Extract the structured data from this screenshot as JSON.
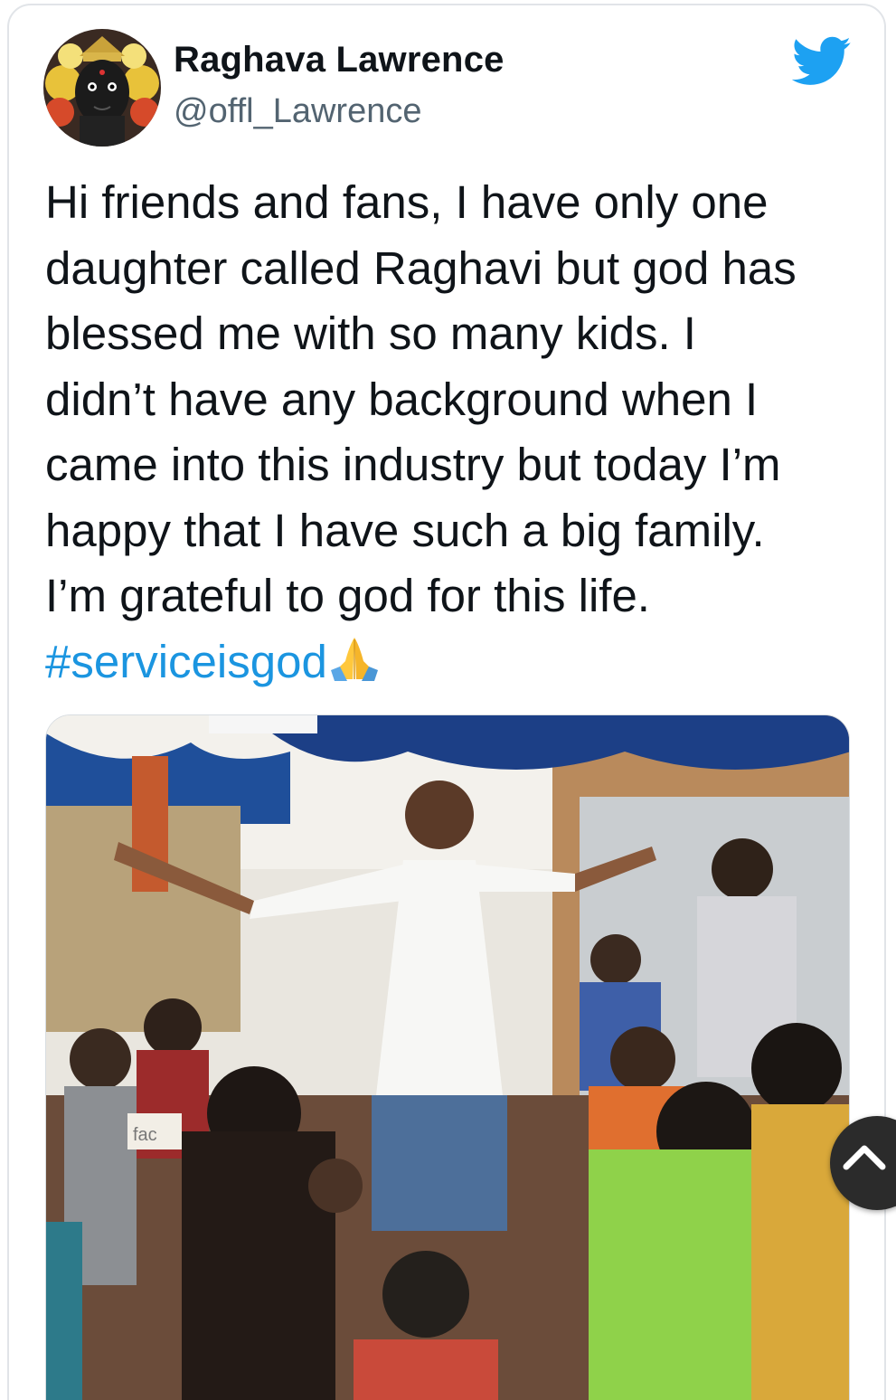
{
  "tweet": {
    "author": {
      "name": "Raghava Lawrence",
      "handle": "@offl_Lawrence"
    },
    "text_lines": [
      "Hi friends and fans, I have only one",
      "daughter called Raghavi but god has",
      "blessed me with so many kids. I",
      "didn’t have any background when I",
      "came into this industry but today I’m",
      "happy that I have such a big family.",
      "I’m grateful to god for this life."
    ],
    "hashtag": "#serviceisgod",
    "emoji_icon": "folded-hands-icon",
    "media": {
      "photo_sign_text": "fac"
    }
  },
  "colors": {
    "twitter_blue": "#1da1f2",
    "hashtag_blue": "#1b95e0",
    "text_primary": "#0f1419",
    "text_secondary": "#536471"
  },
  "icons": {
    "logo": "twitter-bird-icon",
    "scroll": "chevron-up-icon"
  }
}
